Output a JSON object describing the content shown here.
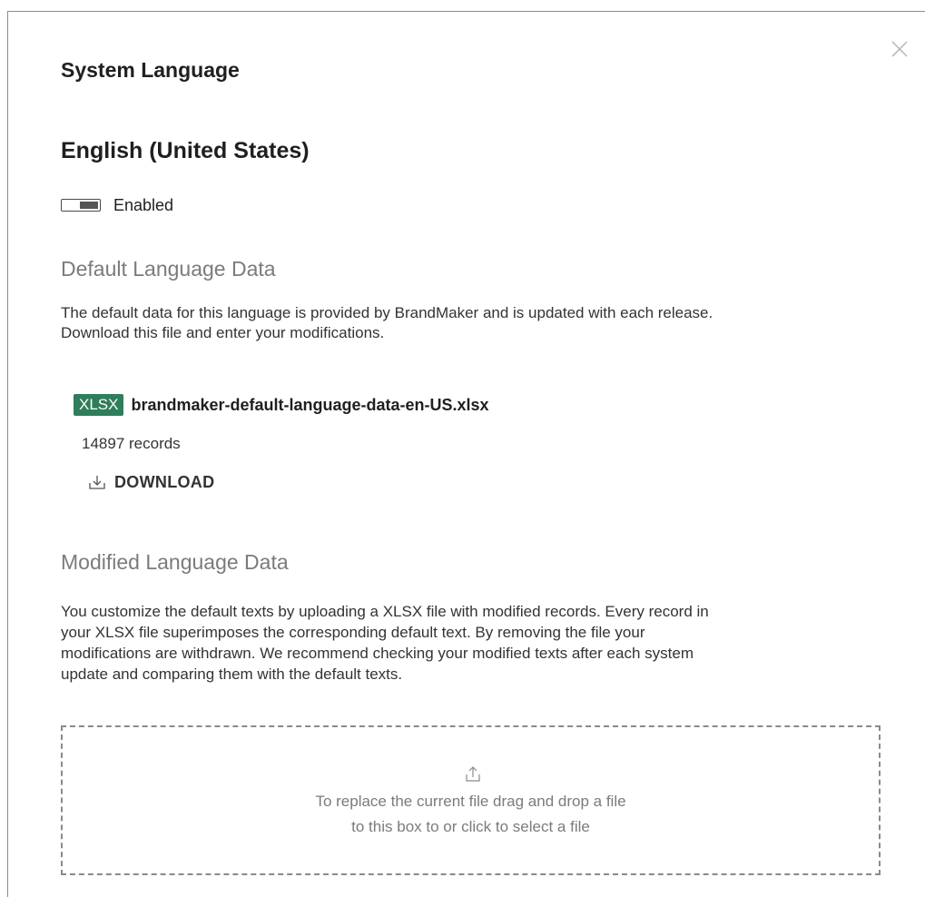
{
  "dialog": {
    "title": "System Language",
    "close_icon": "close-icon"
  },
  "language": {
    "name": "English (United States)",
    "toggle_label": "Enabled",
    "enabled": true
  },
  "default_section": {
    "heading": "Default Language Data",
    "description_line1": "The default data for this language is provided by BrandMaker and is updated with each release.",
    "description_line2": "Download this file and enter your modifications.",
    "file": {
      "badge": "XLSX",
      "badge_color": "#2e7d5b",
      "name": "brandmaker-default-language-data-en-US.xlsx",
      "records": "14897 records"
    },
    "download_label": "DOWNLOAD",
    "download_icon": "download-icon"
  },
  "modified_section": {
    "heading": "Modified Language Data",
    "description_lines": [
      "You customize the default texts by uploading a XLSX file with modified records. Every record in",
      "your XLSX file superimposes the corresponding default text. By removing the file your",
      "modifications are withdrawn. We recommend checking your modified texts after each system",
      "update and comparing them with the default texts."
    ],
    "dropzone": {
      "upload_icon": "upload-icon",
      "line1": "To replace the current file drag and drop a file",
      "line2": "to this box to or click to select a file"
    }
  }
}
